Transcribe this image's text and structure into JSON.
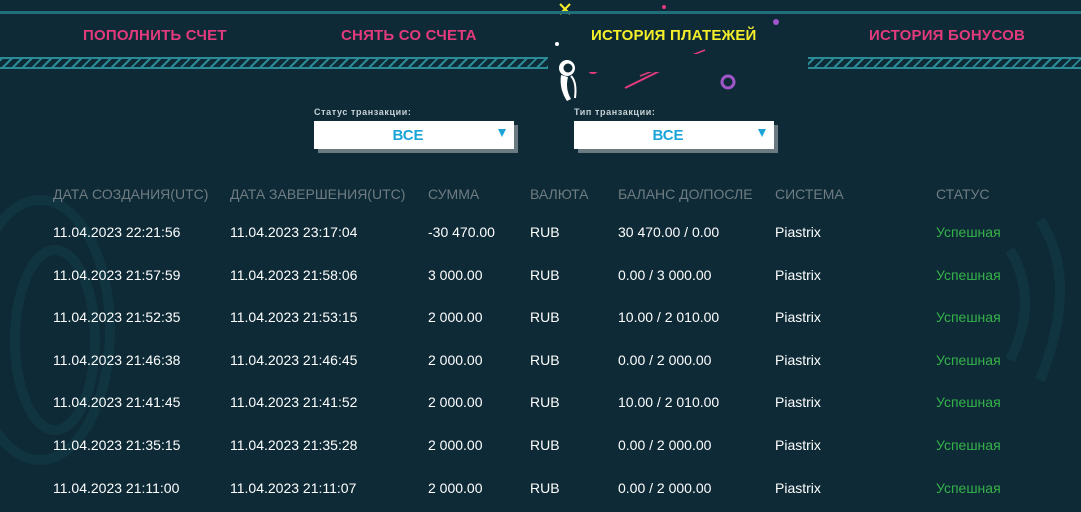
{
  "nav": {
    "items": [
      {
        "label": "ПОПОЛНИТЬ СЧЕТ",
        "active": false
      },
      {
        "label": "СНЯТЬ СО СЧЕТА",
        "active": false
      },
      {
        "label": "ИСТОРИЯ ПЛАТЕЖЕЙ",
        "active": true
      },
      {
        "label": "ИСТОРИЯ БОНУСОВ",
        "active": false
      }
    ]
  },
  "filters": {
    "status": {
      "label": "Статус транзакции:",
      "value": "ВСЕ"
    },
    "type": {
      "label": "Тип транзакции:",
      "value": "ВСЕ"
    }
  },
  "table": {
    "columns": [
      "ДАТА СОЗДАНИЯ(UTC)",
      "ДАТА ЗАВЕРШЕНИЯ(UTC)",
      "СУММА",
      "ВАЛЮТА",
      "БАЛАНС ДО/ПОСЛЕ",
      "СИСТЕМА",
      "СТАТУС"
    ],
    "rows": [
      [
        "11.04.2023 22:21:56",
        "11.04.2023 23:17:04",
        "-30 470.00",
        "RUB",
        "30 470.00 / 0.00",
        "Piastrix",
        "Успешная"
      ],
      [
        "11.04.2023 21:57:59",
        "11.04.2023 21:58:06",
        "3 000.00",
        "RUB",
        "0.00 / 3 000.00",
        "Piastrix",
        "Успешная"
      ],
      [
        "11.04.2023 21:52:35",
        "11.04.2023 21:53:15",
        "2 000.00",
        "RUB",
        "10.00 / 2 010.00",
        "Piastrix",
        "Успешная"
      ],
      [
        "11.04.2023 21:46:38",
        "11.04.2023 21:46:45",
        "2 000.00",
        "RUB",
        "0.00 / 2 000.00",
        "Piastrix",
        "Успешная"
      ],
      [
        "11.04.2023 21:41:45",
        "11.04.2023 21:41:52",
        "2 000.00",
        "RUB",
        "10.00 / 2 010.00",
        "Piastrix",
        "Успешная"
      ],
      [
        "11.04.2023 21:35:15",
        "11.04.2023 21:35:28",
        "2 000.00",
        "RUB",
        "0.00 / 2 000.00",
        "Piastrix",
        "Успешная"
      ],
      [
        "11.04.2023 21:11:00",
        "11.04.2023 21:11:07",
        "2 000.00",
        "RUB",
        "0.00 / 2 000.00",
        "Piastrix",
        "Успешная"
      ]
    ]
  },
  "colors": {
    "background": "#0d2a36",
    "nav_link": "#e23a7c",
    "nav_active": "#f5ef2a",
    "select_text": "#1aa4d8",
    "status_success": "#34b249",
    "header_text": "#6f7c82"
  },
  "decorations": {
    "astronaut_icon": "astronaut-icon",
    "planet_icon": "planet-ring-icon"
  }
}
